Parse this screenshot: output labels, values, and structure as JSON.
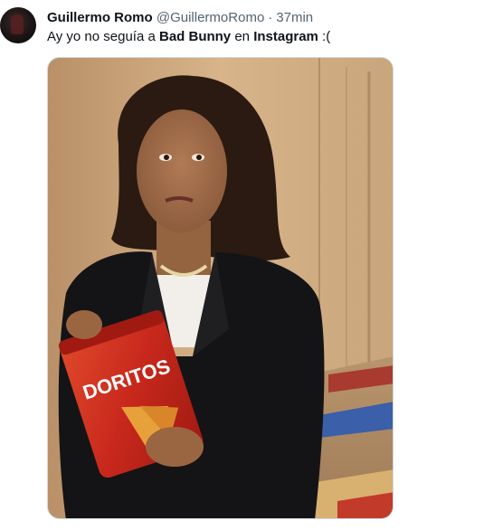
{
  "tweet": {
    "author": {
      "display_name": "Guillermo Romo",
      "handle": "@GuillermoRomo",
      "separator": "·",
      "time": "37min"
    },
    "text": {
      "part1": "Ay yo no seguía a ",
      "bold1": "Bad Bunny",
      "part2": " en ",
      "bold2": "Instagram",
      "part3": " :("
    },
    "media": {
      "bag_brand": "DORITOS",
      "colors": {
        "bag_red": "#c8281c",
        "jacket": "#141416",
        "wall": "#d2ad82",
        "carpet_blue": "#3b5fa8"
      }
    }
  }
}
